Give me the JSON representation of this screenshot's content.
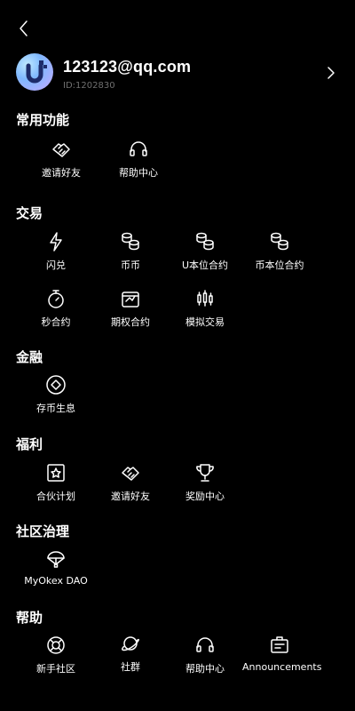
{
  "profile": {
    "email": "123123@qq.com",
    "uid": "ID:1202830"
  },
  "sections": {
    "common": {
      "title": "常用功能",
      "items": [
        "邀请好友",
        "帮助中心"
      ]
    },
    "trade": {
      "title": "交易",
      "items": [
        "闪兑",
        "币币",
        "U本位合约",
        "币本位合约",
        "秒合约",
        "期权合约",
        "模拟交易"
      ]
    },
    "finance": {
      "title": "金融",
      "items": [
        "存币生息"
      ]
    },
    "welfare": {
      "title": "福利",
      "items": [
        "合伙计划",
        "邀请好友",
        "奖励中心"
      ]
    },
    "community": {
      "title": "社区治理",
      "items": [
        "MyOkex DAO"
      ]
    },
    "help": {
      "title": "帮助",
      "items": [
        "新手社区",
        "社群",
        "帮助中心",
        "Announcements"
      ]
    }
  }
}
